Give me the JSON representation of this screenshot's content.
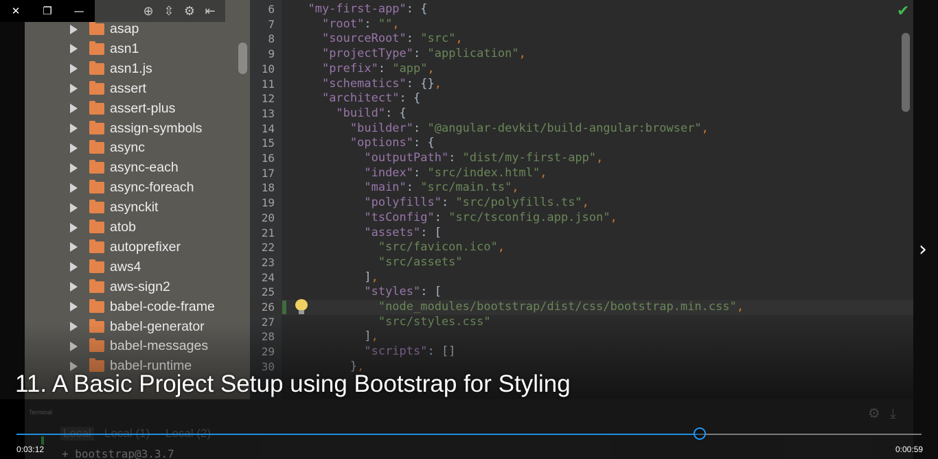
{
  "window": {
    "close_glyph": "✕",
    "restore_glyph": "❐",
    "minimize_glyph": "—"
  },
  "tree": {
    "toolbar_icons": [
      "crosshair-icon",
      "collapse-icon",
      "gear-icon",
      "hide-panel-icon"
    ],
    "items": [
      {
        "label": "asap"
      },
      {
        "label": "asn1"
      },
      {
        "label": "asn1.js"
      },
      {
        "label": "assert"
      },
      {
        "label": "assert-plus"
      },
      {
        "label": "assign-symbols"
      },
      {
        "label": "async"
      },
      {
        "label": "async-each"
      },
      {
        "label": "async-foreach"
      },
      {
        "label": "asynckit"
      },
      {
        "label": "atob"
      },
      {
        "label": "autoprefixer"
      },
      {
        "label": "aws4"
      },
      {
        "label": "aws-sign2"
      },
      {
        "label": "babel-code-frame"
      },
      {
        "label": "babel-generator"
      },
      {
        "label": "babel-messages"
      },
      {
        "label": "babel-runtime"
      }
    ]
  },
  "editor": {
    "lines": [
      {
        "num": "6",
        "html": "  <span class='k'>\"my-first-app\"</span><span class='b'>: {</span>"
      },
      {
        "num": "7",
        "html": "    <span class='k'>\"root\"</span><span class='b'>: </span><span class='s'>\"\"</span><span class='p'>,</span>"
      },
      {
        "num": "8",
        "html": "    <span class='k'>\"sourceRoot\"</span><span class='b'>: </span><span class='s'>\"src\"</span><span class='p'>,</span>"
      },
      {
        "num": "9",
        "html": "    <span class='k'>\"projectType\"</span><span class='b'>: </span><span class='s'>\"application\"</span><span class='p'>,</span>"
      },
      {
        "num": "10",
        "html": "    <span class='k'>\"prefix\"</span><span class='b'>: </span><span class='s'>\"app\"</span><span class='p'>,</span>"
      },
      {
        "num": "11",
        "html": "    <span class='k'>\"schematics\"</span><span class='b'>: {}</span><span class='p'>,</span>"
      },
      {
        "num": "12",
        "html": "    <span class='k'>\"architect\"</span><span class='b'>: {</span>"
      },
      {
        "num": "13",
        "html": "      <span class='k'>\"build\"</span><span class='b'>: {</span>"
      },
      {
        "num": "14",
        "html": "        <span class='k'>\"builder\"</span><span class='b'>: </span><span class='s'>\"@angular-devkit/build-angular:browser\"</span><span class='p'>,</span>"
      },
      {
        "num": "15",
        "html": "        <span class='k'>\"options\"</span><span class='b'>: {</span>"
      },
      {
        "num": "16",
        "html": "          <span class='k'>\"outputPath\"</span><span class='b'>: </span><span class='s'>\"dist/my-first-app\"</span><span class='p'>,</span>"
      },
      {
        "num": "17",
        "html": "          <span class='k'>\"index\"</span><span class='b'>: </span><span class='s'>\"src/index.html\"</span><span class='p'>,</span>"
      },
      {
        "num": "18",
        "html": "          <span class='k'>\"main\"</span><span class='b'>: </span><span class='s'>\"src/main.ts\"</span><span class='p'>,</span>"
      },
      {
        "num": "19",
        "html": "          <span class='k'>\"polyfills\"</span><span class='b'>: </span><span class='s'>\"src/polyfills.ts\"</span><span class='p'>,</span>"
      },
      {
        "num": "20",
        "html": "          <span class='k'>\"tsConfig\"</span><span class='b'>: </span><span class='s'>\"src/tsconfig.app.json\"</span><span class='p'>,</span>"
      },
      {
        "num": "21",
        "html": "          <span class='k'>\"assets\"</span><span class='b'>: [</span>"
      },
      {
        "num": "22",
        "html": "            <span class='s'>\"src/favicon.ico\"</span><span class='p'>,</span>"
      },
      {
        "num": "23",
        "html": "            <span class='s'>\"src/assets\"</span>"
      },
      {
        "num": "24",
        "html": "          <span class='b'>]</span><span class='p'>,</span>"
      },
      {
        "num": "25",
        "html": "          <span class='k'>\"styles\"</span><span class='b'>: [</span>"
      },
      {
        "num": "26",
        "html": "            <span class='s'>\"node_modules/bootstrap/dist/css/bootstrap.min.css\"</span><span class='p'>,</span>"
      },
      {
        "num": "27",
        "html": "            <span class='s'>\"src/styles.css\"</span>"
      },
      {
        "num": "28",
        "html": "          <span class='b'>]</span><span class='p'>,</span>"
      },
      {
        "num": "29",
        "html": "          <span class='k'>\"scripts\"</span><span class='b'>: []</span>"
      },
      {
        "num": "30",
        "html": "        <span class='b'>}</span><span class='p'>,</span>"
      }
    ]
  },
  "caption": {
    "title": "11. A Basic Project Setup using Bootstrap for Styling"
  },
  "terminal": {
    "title": "Terminal",
    "tabs": [
      "Local",
      "Local (1)",
      "Local (2)"
    ],
    "output": "+ bootstrap@3.3.7"
  },
  "player": {
    "progress": 0.755,
    "elapsed": "0:03:12",
    "remaining": "0:00:59"
  },
  "colors": {
    "folder": "#e4844a",
    "seek_played": "#1f8fe0",
    "check": "#3fb950"
  }
}
